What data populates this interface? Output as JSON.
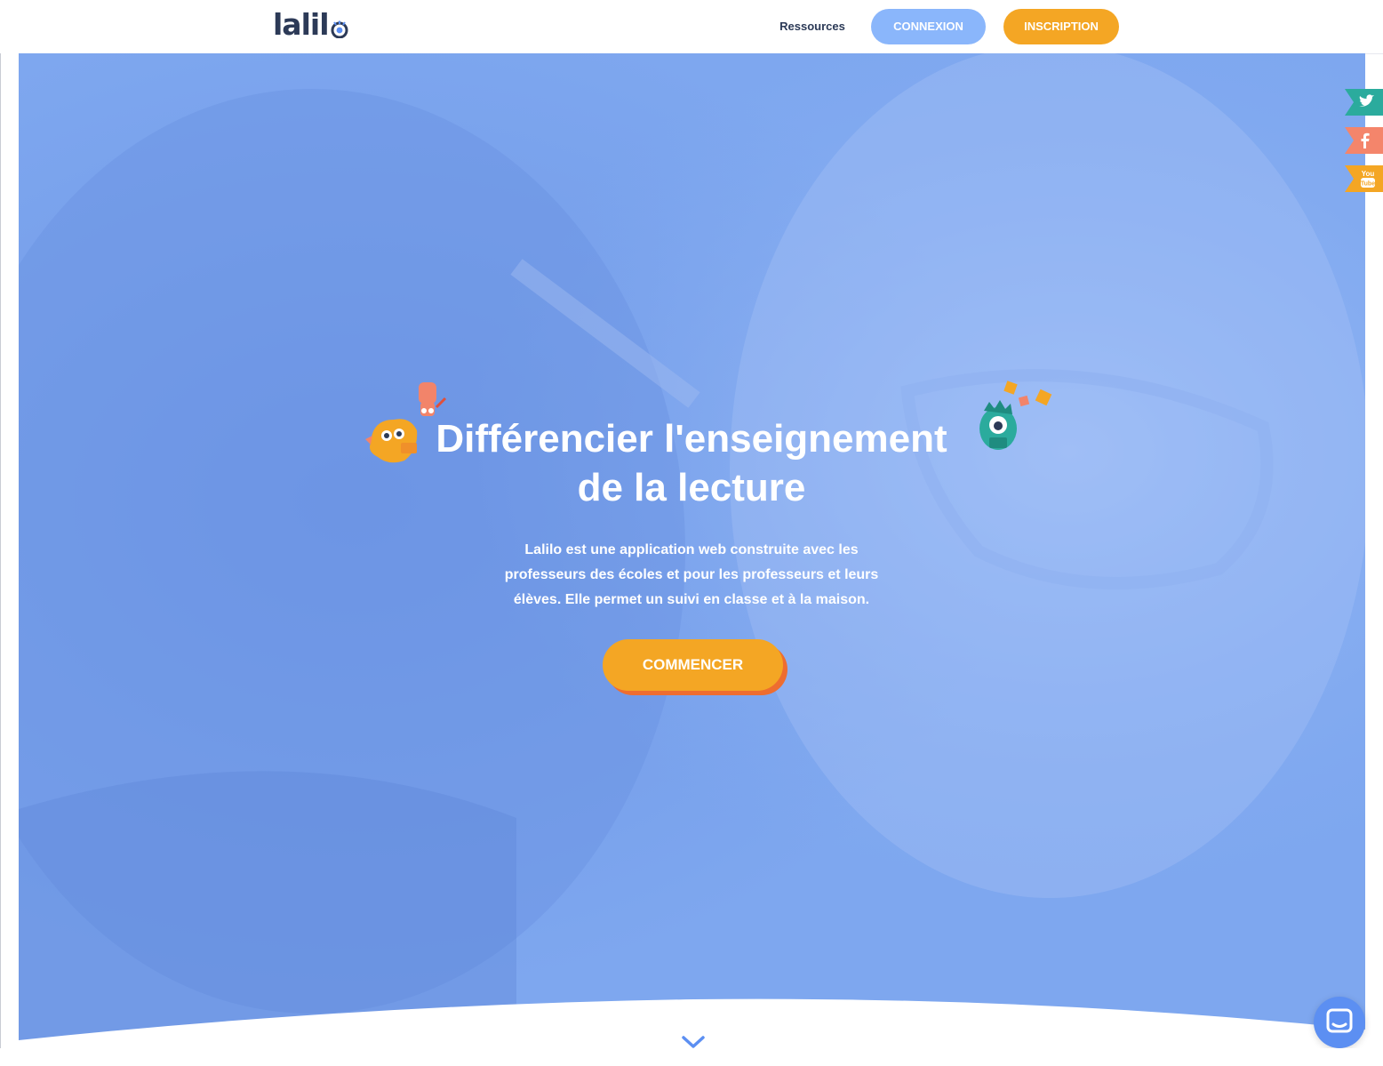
{
  "brand": {
    "name": "lalil",
    "logo_icon": "eye-logo-icon",
    "accent": "#2c3a57"
  },
  "nav": {
    "resources_label": "Ressources",
    "login_label": "CONNEXION",
    "signup_label": "INSCRIPTION",
    "login_color": "#8ab6fb",
    "signup_color": "#f4a624"
  },
  "hero": {
    "title_line1": "Différencier l'enseignement",
    "title_line2": "de la lecture",
    "description": "Lalilo est une application web construite avec les professeurs des écoles et pour les professeurs et leurs élèves. Elle permet un suivi en classe et à la maison.",
    "cta_label": "COMMENCER",
    "overlay_color": "#7ea7ef",
    "cta_color": "#f4a624",
    "scroll_icon": "chevron-down-icon"
  },
  "social": [
    {
      "name": "twitter-icon",
      "color": "#2bab9d"
    },
    {
      "name": "facebook-icon",
      "color": "#f4856b"
    },
    {
      "name": "youtube-icon",
      "color": "#f4a624"
    }
  ],
  "chat": {
    "icon": "chat-icon",
    "color": "#5c8ff2"
  }
}
